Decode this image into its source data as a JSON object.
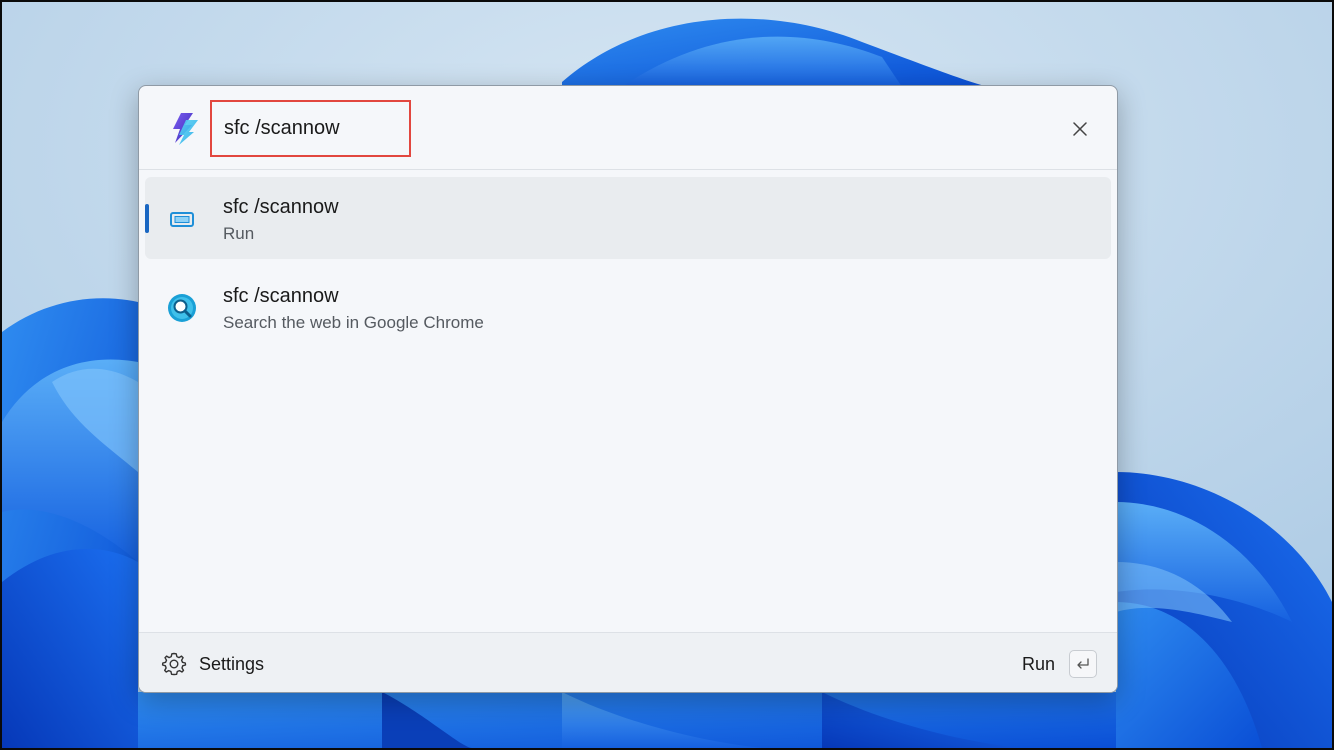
{
  "search": {
    "value": "sfc /scannow"
  },
  "results": [
    {
      "title": "sfc /scannow",
      "subtitle": "Run",
      "icon": "run-command-icon",
      "selected": true
    },
    {
      "title": "sfc /scannow",
      "subtitle": "Search the web in Google Chrome",
      "icon": "web-search-icon",
      "selected": false
    }
  ],
  "footer": {
    "settings_label": "Settings",
    "run_label": "Run",
    "run_key_icon": "enter-key-icon"
  },
  "icons": {
    "app_logo": "powertoys-run-logo-icon",
    "close": "close-icon",
    "settings": "gear-icon"
  },
  "colors": {
    "accent": "#1a67c2",
    "highlight_box": "#e2473f",
    "selected_row": "#e9ecef"
  }
}
